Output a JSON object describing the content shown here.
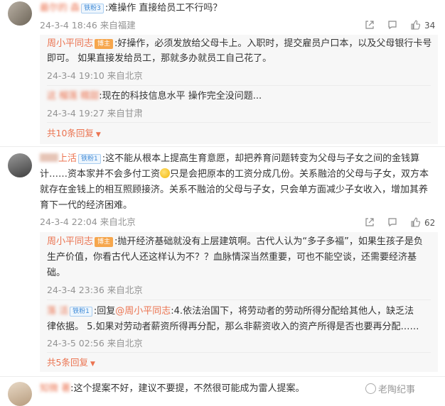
{
  "thread": [
    {
      "user": "最尔的 森",
      "badge": "铁粉3",
      "text": ":难操作 直接给员工不行吗？",
      "time": "24-3-4 18:46 来自福建",
      "likes": "34",
      "replies": [
        {
          "user": "周小平同志",
          "badge": "博主",
          "lines": [
            ":好操作，必须发放给父母卡上。入职时，提交雇员户口本，以及父母银行卡号",
            "即可。 如果直接发给员工，那就多办就员工自己花了。"
          ],
          "time": "24-3-4 19:10 来自北京"
        },
        {
          "user": "这 榴莲 糯甜",
          "text": ":现在的科技信息水平 操作完全没问题...",
          "time": "24-3-4 19:27 来自甘肃"
        }
      ],
      "expand": "共10条回复"
    },
    {
      "user": "上活",
      "badge": "铁粉1",
      "lines": [
        ":这不能从根本上提高生育意愿，却把养育问题转变为父母与子女之间的金钱算",
        "计……资本家并不会多付工资",
        "只是会把原本的工资分成几份。关系融洽的父母与子女，双方本",
        "就存在金钱上的相互照顾接济。关系不融洽的父母与子女，只会单方面减少子女收入，增加其养",
        "育下一代的经济困难。"
      ],
      "time": "24-3-4 22:04 来自北京",
      "likes": "62",
      "replies": [
        {
          "user": "周小平同志",
          "badge": "博主",
          "lines": [
            ":抛开经济基础就没有上层建筑啊。古代人认为“多子多福”，如果生孩子是负",
            "生产价值，你看古代人还这样认为不？？血脉情深当然重要，可也不能空谈，还需要经济基",
            "础。"
          ],
          "time": "24-3-4 23:36 来自北京"
        },
        {
          "user": "落 活",
          "badge": "铁粉1",
          "lines": [
            ":回复",
            "@周小平同志",
            ":4.依法治国下，将劳动者的劳动所得分配给其他人，缺乏法",
            "律依据。 5.如果对劳动者薪资所得再分配，那么非薪资收入的资产所得是否也要再分配……"
          ],
          "time": "24-3-5 02:56 来自北京"
        }
      ],
      "expand": "共5条回复"
    },
    {
      "user": "知微 著",
      "text": ":这个提案不好，建议不要提，不然很可能成为雷人提案。"
    }
  ],
  "watermark": "老陶纪事",
  "icons": [
    "share-icon",
    "comment-icon",
    "like-icon",
    "chevron-down-icon"
  ],
  "colors": {
    "username": "#eb7350",
    "meta": "#939393",
    "sub_bg": "#f7f7f7"
  }
}
